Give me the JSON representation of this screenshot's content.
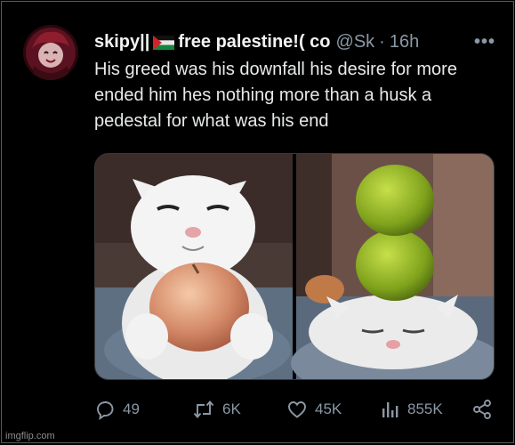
{
  "tweet": {
    "display_name": "skipy||",
    "name_suffix": "free palestine!( co",
    "handle": "@Sk",
    "separator": "·",
    "time": "16h",
    "more": "•••",
    "text": "His greed was his downfall his desire for more ended him hes nothing more than a husk a pedestal for what was his end"
  },
  "actions": {
    "replies": "49",
    "reposts": "6K",
    "likes": "45K",
    "views": "855K"
  },
  "watermark": "imgflip.com",
  "colors": {
    "background": "#000000",
    "text": "#e7e9ea",
    "muted": "#8b98a5"
  }
}
